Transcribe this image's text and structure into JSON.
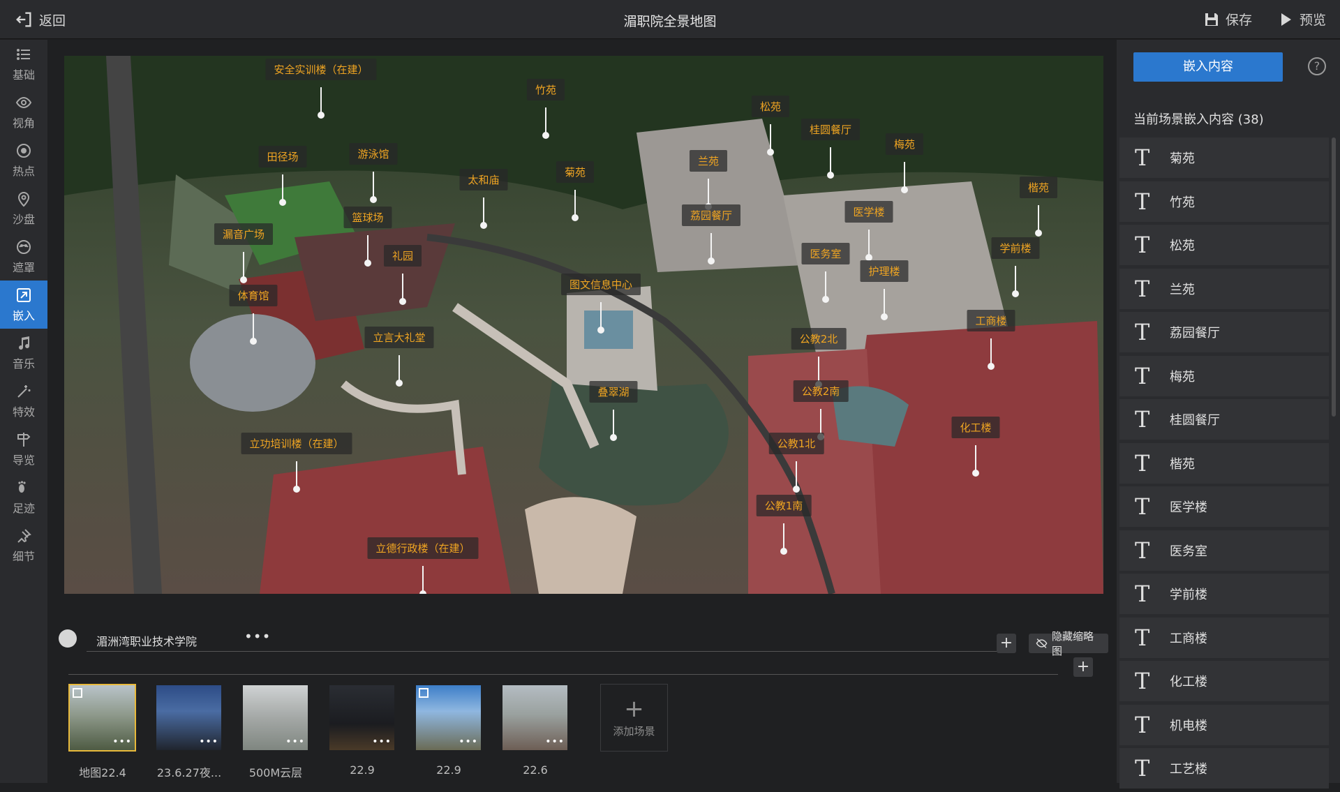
{
  "topbar": {
    "back_label": "返回",
    "title": "湄职院全景地图",
    "save_label": "保存",
    "preview_label": "预览"
  },
  "nav": {
    "items": [
      {
        "label": "基础",
        "icon": "list-icon"
      },
      {
        "label": "视角",
        "icon": "eye-icon"
      },
      {
        "label": "热点",
        "icon": "target-icon"
      },
      {
        "label": "沙盘",
        "icon": "map-pin-icon"
      },
      {
        "label": "遮罩",
        "icon": "mask-icon"
      },
      {
        "label": "嵌入",
        "icon": "embed-icon",
        "active": true
      },
      {
        "label": "音乐",
        "icon": "music-icon"
      },
      {
        "label": "特效",
        "icon": "magic-icon"
      },
      {
        "label": "导览",
        "icon": "signpost-icon"
      },
      {
        "label": "足迹",
        "icon": "footprint-icon"
      },
      {
        "label": "细节",
        "icon": "pin-icon"
      }
    ]
  },
  "map": {
    "labels": [
      {
        "text": "安全实训楼（在建）"
      },
      {
        "text": "竹苑"
      },
      {
        "text": "松苑"
      },
      {
        "text": "桂圆餐厅"
      },
      {
        "text": "梅苑"
      },
      {
        "text": "田径场"
      },
      {
        "text": "游泳馆"
      },
      {
        "text": "太和庙"
      },
      {
        "text": "菊苑"
      },
      {
        "text": "兰苑"
      },
      {
        "text": "楷苑"
      },
      {
        "text": "篮球场"
      },
      {
        "text": "荔园餐厅"
      },
      {
        "text": "医学楼"
      },
      {
        "text": "漏音广场"
      },
      {
        "text": "礼园"
      },
      {
        "text": "医务室"
      },
      {
        "text": "学前楼"
      },
      {
        "text": "护理楼"
      },
      {
        "text": "体育馆"
      },
      {
        "text": "图文信息中心"
      },
      {
        "text": "立言大礼堂"
      },
      {
        "text": "工商楼"
      },
      {
        "text": "公教2北"
      },
      {
        "text": "叠翠湖"
      },
      {
        "text": "公教2南"
      },
      {
        "text": "化工楼"
      },
      {
        "text": "立功培训楼（在建）"
      },
      {
        "text": "公教1北"
      },
      {
        "text": "公教1南"
      },
      {
        "text": "立德行政楼（在建）"
      }
    ]
  },
  "bottom": {
    "scene_group_name": "湄洲湾职业技术学院",
    "more_glyph": "•••",
    "hide_thumb_label": "隐藏缩略图",
    "add_scene_label": "添加场景",
    "scenes": [
      {
        "label": "地图22.4",
        "selected": true,
        "pano": true
      },
      {
        "label": "23.6.27夜...",
        "selected": false,
        "pano": false
      },
      {
        "label": "500M云层",
        "selected": false,
        "pano": false
      },
      {
        "label": "22.9",
        "selected": false,
        "pano": false
      },
      {
        "label": "22.9",
        "selected": false,
        "pano": true
      },
      {
        "label": "22.6",
        "selected": false,
        "pano": false
      }
    ]
  },
  "right": {
    "embed_button": "嵌入内容",
    "help_glyph": "?",
    "header": "当前场景嵌入内容 (38)",
    "text_icon_glyph": "T",
    "items": [
      "菊苑",
      "竹苑",
      "松苑",
      "兰苑",
      "荔园餐厅",
      "梅苑",
      "桂圆餐厅",
      "楷苑",
      "医学楼",
      "医务室",
      "学前楼",
      "工商楼",
      "化工楼",
      "机电楼",
      "工艺楼"
    ]
  },
  "colors": {
    "accent": "#2b78ce",
    "label_text": "#f0a522",
    "selected_thumb": "#e8b93b"
  }
}
